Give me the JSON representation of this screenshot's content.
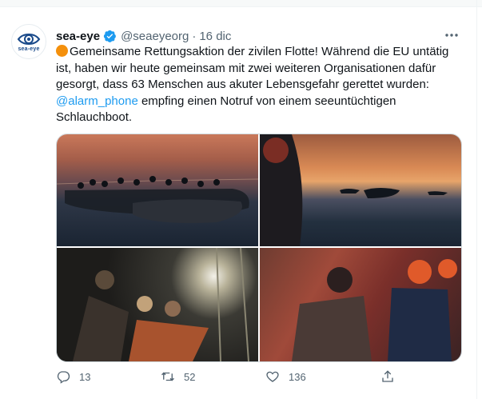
{
  "tweet": {
    "avatar_label": "sea-eye",
    "display_name": "sea-eye",
    "handle": "@seaeyeorg",
    "separator": "·",
    "date": "16 dic",
    "text_part1": "Gemeinsame Rettungsaktion der zivilen Flotte! Während die EU untätig ist, haben wir heute gemeinsam mit zwei weiteren Organisationen dafür gesorgt, dass 63 Menschen aus akuter Lebensgefahr gerettet wurden:",
    "mention": "@alarm_phone",
    "text_part2": " empfing einen Notruf von einem seeuntüchtigen Schlauchboot.",
    "emoji_icon": "orange-circle-emoji"
  },
  "actions": {
    "reply_count": "13",
    "retweet_count": "52",
    "like_count": "136"
  },
  "colors": {
    "link": "#1d9bf0",
    "secondary_text": "#536471",
    "verified": "#1d9bf0",
    "emoji": "#f4900c"
  }
}
